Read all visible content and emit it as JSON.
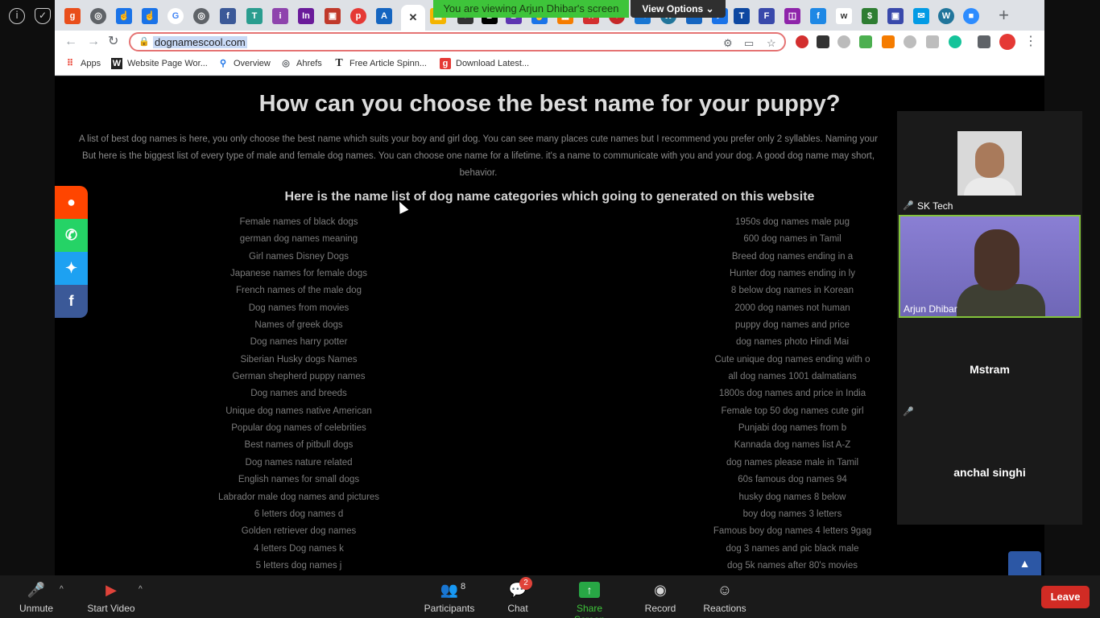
{
  "zoom": {
    "sharing_banner": "You are viewing Arjun Dhibar's screen",
    "view_options": "View Options",
    "participants": [
      {
        "name": "SK Tech"
      },
      {
        "name": "Arjun Dhibar"
      },
      {
        "name": "Mstram"
      },
      {
        "name": "anchal singhi"
      }
    ],
    "bottom_bar": {
      "unmute": "Unmute",
      "start_video": "Start Video",
      "participants": "Participants",
      "participants_count": "8",
      "chat": "Chat",
      "chat_badge": "2",
      "share_screen": "Share Screen",
      "record": "Record",
      "reactions": "Reactions",
      "leave": "Leave"
    }
  },
  "browser": {
    "url": "dognamescool.com",
    "bookmarks": [
      {
        "label": "Apps",
        "icon": "apps-grid-icon"
      },
      {
        "label": "Website Page Wor...",
        "icon": "w-logo-icon"
      },
      {
        "label": "Overview",
        "icon": "overview-icon"
      },
      {
        "label": "Ahrefs",
        "icon": "globe-icon"
      },
      {
        "label": "Free Article Spinn...",
        "icon": "t-logo-icon"
      },
      {
        "label": "Download Latest...",
        "icon": "g-logo-icon"
      }
    ],
    "accent": "#e57373"
  },
  "page": {
    "title": "How can you choose the best name for your puppy?",
    "intro_1": "A list of best dog names is here, you only choose the best name which suits your boy and girl dog. You can see many places cute names but I recommend you prefer only 2 syllables. Naming your",
    "intro_2": "But here is the biggest list of every type of male and female dog names. You can choose one name for a lifetime. it's a name to communicate with you and your dog. A good dog name may short,",
    "intro_3": "behavior.",
    "subtitle": "Here is the name list of dog name categories which going to generated on this website",
    "left_list": [
      "Female names of black dogs",
      "german dog names meaning",
      "Girl names Disney Dogs",
      "Japanese names for female dogs",
      "French names of the male dog",
      "Dog names from movies",
      "Names of greek dogs",
      "Dog names harry potter",
      "Siberian Husky dogs Names",
      "German shepherd puppy names",
      "Dog names and breeds",
      "Unique dog names native American",
      "Popular dog names of celebrities",
      "Best names of pitbull dogs",
      "Dog names nature related",
      "English names for small dogs",
      "Labrador male dog names and pictures",
      "6 letters dog names d",
      "Golden retriever dog names",
      "4 letters Dog names k",
      "5 letters dog names j"
    ],
    "right_list": [
      "1950s dog names male pug",
      "600 dog names in Tamil",
      "Breed dog names ending in a",
      "Hunter dog names ending in ly",
      "8 below dog names in Korean",
      "2000 dog names not human",
      "puppy dog names and price",
      "dog names photo Hindi Mai",
      "Cute unique dog names ending with o",
      "all dog names 1001 dalmatians",
      "1800s dog names and price in India",
      "Female top 50 dog names cute girl",
      "Punjabi dog names from b",
      "Kannada dog names list A-Z",
      "dog names please male in Tamil",
      "60s famous dog names 94",
      "husky dog names 8 below",
      "boy dog names 3 letters",
      "Famous boy dog names 4 letters 9gag",
      "dog 3 names and pic black male",
      "dog 5k names after 80's movies"
    ],
    "social": [
      {
        "name": "reddit",
        "color": "#ff4500"
      },
      {
        "name": "whatsapp",
        "color": "#25d366"
      },
      {
        "name": "twitter",
        "color": "#1da1f2"
      },
      {
        "name": "facebook",
        "color": "#3b5998"
      }
    ]
  }
}
